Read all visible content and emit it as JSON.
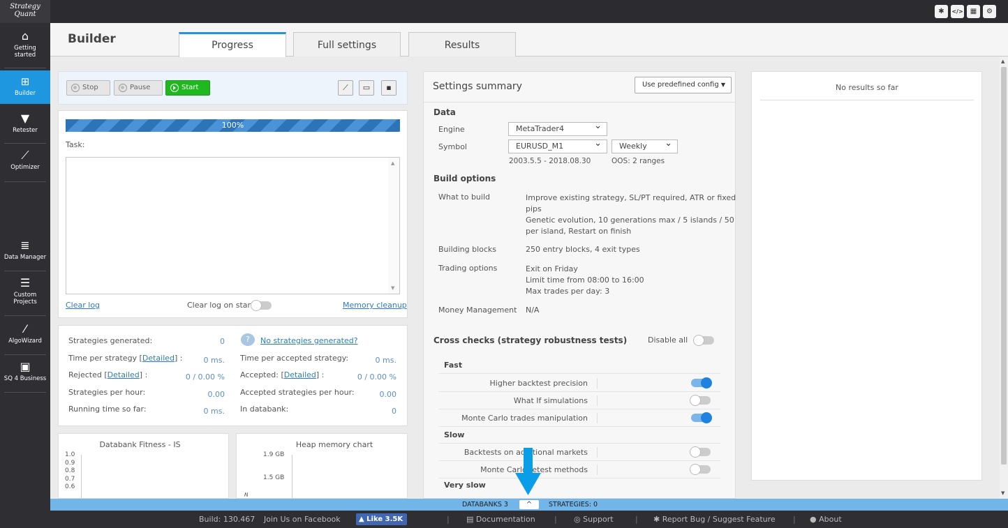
{
  "app": {
    "logo_line1": "Strategy",
    "logo_line2": "Quant"
  },
  "topbar_icons": [
    "bug-icon",
    "code-icon",
    "grid-icon",
    "gear-icon"
  ],
  "sidebar": {
    "items": [
      {
        "label1": "Getting",
        "label2": "started",
        "icon": "home-icon"
      },
      {
        "label1": "Builder",
        "label2": "",
        "icon": "plus-square-icon",
        "active": true
      },
      {
        "label1": "Retester",
        "label2": "",
        "icon": "filter-icon"
      },
      {
        "label1": "Optimizer",
        "label2": "",
        "icon": "chart-line-icon"
      },
      {
        "label1": "Data Manager",
        "label2": "",
        "icon": "database-icon"
      },
      {
        "label1": "Custom",
        "label2": "Projects",
        "icon": "server-icon"
      },
      {
        "label1": "AlgoWizard",
        "label2": "",
        "icon": "magic-wand-icon"
      },
      {
        "label1": "SQ 4 Business",
        "label2": "",
        "icon": "briefcase-icon"
      }
    ]
  },
  "header": {
    "title": "Builder",
    "tabs": [
      {
        "label": "Progress",
        "active": true
      },
      {
        "label": "Full settings",
        "active": false
      },
      {
        "label": "Results",
        "active": false
      }
    ]
  },
  "controls": {
    "stop": "Stop",
    "pause": "Pause",
    "start": "Start"
  },
  "progress": {
    "percent_label": "100%",
    "value": 1.0,
    "task_label": "Task:"
  },
  "log": {
    "clear": "Clear log",
    "clear_on_start": "Clear log on start",
    "memory_cleanup": "Memory cleanup"
  },
  "stats": {
    "generated_label": "Strategies generated:",
    "generated": "0",
    "no_strategies_link": "No strategies generated?",
    "time_per_label_a": "Time per strategy [",
    "detailed": "Detailed",
    "time_per_label_b": "] :",
    "time_per": "0 ms.",
    "time_accepted_label": "Time per accepted strategy:",
    "time_accepted": "0 ms.",
    "rejected_label_a": "Rejected [",
    "rejected_label_b": "] :",
    "rejected": "0 / 0.00 %",
    "accepted_label_a": "Accepted: [",
    "accepted_label_b": "] :",
    "accepted": "0 / 0.00 %",
    "per_hour_label": "Strategies per hour:",
    "per_hour": "0.00",
    "accepted_per_hour_label": "Accepted strategies per hour:",
    "accepted_per_hour": "0.00",
    "running_label": "Running time so far:",
    "running": "0 ms.",
    "in_databank_label": "In databank:",
    "in_databank": "0"
  },
  "fitness_chart": {
    "title": "Databank Fitness - IS",
    "ticks": [
      "1.0",
      "0.9",
      "0.8",
      "0.7",
      "0.6"
    ]
  },
  "heap_chart": {
    "title": "Heap memory chart",
    "ticks": [
      "1.9 GB",
      "1.5 GB"
    ],
    "axis_glyph": "≥"
  },
  "settings": {
    "title": "Settings summary",
    "predefined": "Use predefined config",
    "data_header": "Data",
    "engine_label": "Engine",
    "engine": "MetaTrader4",
    "symbol_label": "Symbol",
    "symbol": "EURUSD_M1",
    "timeframe": "Weekly",
    "date_range": "2003.5.5 - 2018.08.30",
    "oos": "OOS: 2 ranges",
    "build_header": "Build options",
    "what_label": "What to build",
    "what_lines": [
      "Improve existing strategy, SL/PT required, ATR or fixed",
      "pips",
      "Genetic evolution, 10 generations max / 5 islands / 50",
      "per island, Restart on finish"
    ],
    "blocks_label": "Building blocks",
    "blocks": "250 entry blocks, 4 exit types",
    "trading_label": "Trading options",
    "trading_lines": [
      "Exit on Friday",
      "Limit time from 08:00 to 16:00",
      "Max trades per day: 3"
    ],
    "mm_label": "Money Management",
    "mm": "N/A",
    "cc_header": "Cross checks (strategy robustness tests)",
    "disable_all": "Disable all",
    "fast_header": "Fast",
    "slow_header": "Slow",
    "very_slow_header": "Very slow",
    "fast": [
      {
        "label": "Higher backtest precision",
        "on": true
      },
      {
        "label": "What If simulations",
        "on": false
      },
      {
        "label": "Monte Carlo trades manipulation",
        "on": true
      }
    ],
    "slow": [
      {
        "label": "Backtests on additional markets",
        "on": false
      },
      {
        "label": "Monte Carlo retest methods",
        "on": false
      }
    ]
  },
  "results": {
    "empty": "No results so far"
  },
  "dbbar": {
    "databanks": "DATABANKS 3",
    "strategies": "STRATEGIES: 0"
  },
  "footer": {
    "build": "Build: 130.467",
    "facebook": "Join Us on Facebook",
    "like": "Like 3.5K",
    "documentation": "Documentation",
    "support": "Support",
    "report": "Report Bug / Suggest Feature",
    "about": "About"
  },
  "colors": {
    "accent": "#1f96e0",
    "start_green": "#1fb91f",
    "arrow": "#0a9ee8",
    "dbbar": "#72b5e8"
  }
}
